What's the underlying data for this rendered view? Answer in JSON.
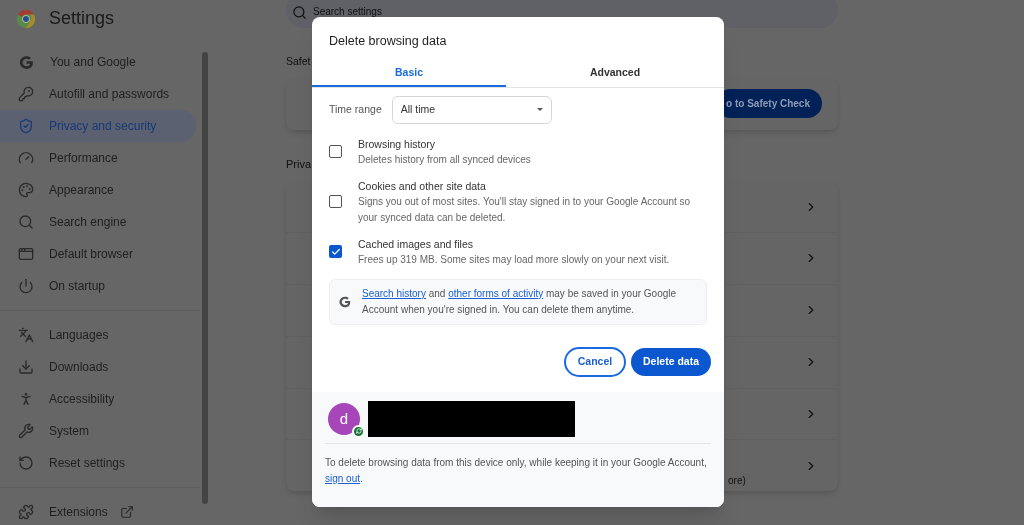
{
  "header": {
    "title": "Settings"
  },
  "search": {
    "placeholder": "Search settings"
  },
  "sidebar": {
    "groups": [
      [
        {
          "label": "You and Google",
          "selected": false
        },
        {
          "label": "Autofill and passwords",
          "selected": false
        },
        {
          "label": "Privacy and security",
          "selected": true
        },
        {
          "label": "Performance",
          "selected": false
        },
        {
          "label": "Appearance",
          "selected": false
        },
        {
          "label": "Search engine",
          "selected": false
        },
        {
          "label": "Default browser",
          "selected": false
        },
        {
          "label": "On startup",
          "selected": false
        }
      ],
      [
        {
          "label": "Languages",
          "selected": false
        },
        {
          "label": "Downloads",
          "selected": false
        },
        {
          "label": "Accessibility",
          "selected": false
        },
        {
          "label": "System",
          "selected": false
        },
        {
          "label": "Reset settings",
          "selected": false
        }
      ],
      [
        {
          "label": "Extensions",
          "selected": false
        }
      ]
    ]
  },
  "main": {
    "safety_heading": "Safet",
    "safety_button": "o to Safety Check",
    "privacy_heading": "Priva",
    "privacy_last_row_text": "ore)"
  },
  "dialog": {
    "title": "Delete browsing data",
    "tabs": [
      {
        "label": "Basic",
        "selected": true
      },
      {
        "label": "Advanced",
        "selected": false
      }
    ],
    "time_range": {
      "label": "Time range",
      "value": "All time"
    },
    "options": [
      {
        "title": "Browsing history",
        "description": "Deletes history from all synced devices",
        "checked": false
      },
      {
        "title": "Cookies and other site data",
        "description": "Signs you out of most sites. You'll stay signed in to your Google Account so your synced data can be deleted.",
        "checked": false
      },
      {
        "title": "Cached images and files",
        "description": "Frees up 319 MB. Some sites may load more slowly on your next visit.",
        "checked": true
      }
    ],
    "notice": {
      "link_1": "Search history",
      "text_1": " and ",
      "link_2": "other forms of activity",
      "text_2": " may be saved in your Google Account when you're signed in. You can delete them anytime."
    },
    "cancel": "Cancel",
    "confirm": "Delete data",
    "account": {
      "initial": "d",
      "synced": true
    },
    "footer": {
      "text": "To delete browsing data from this device only, while keeping it in your Google Account, ",
      "link": "sign out",
      "after": "."
    }
  }
}
